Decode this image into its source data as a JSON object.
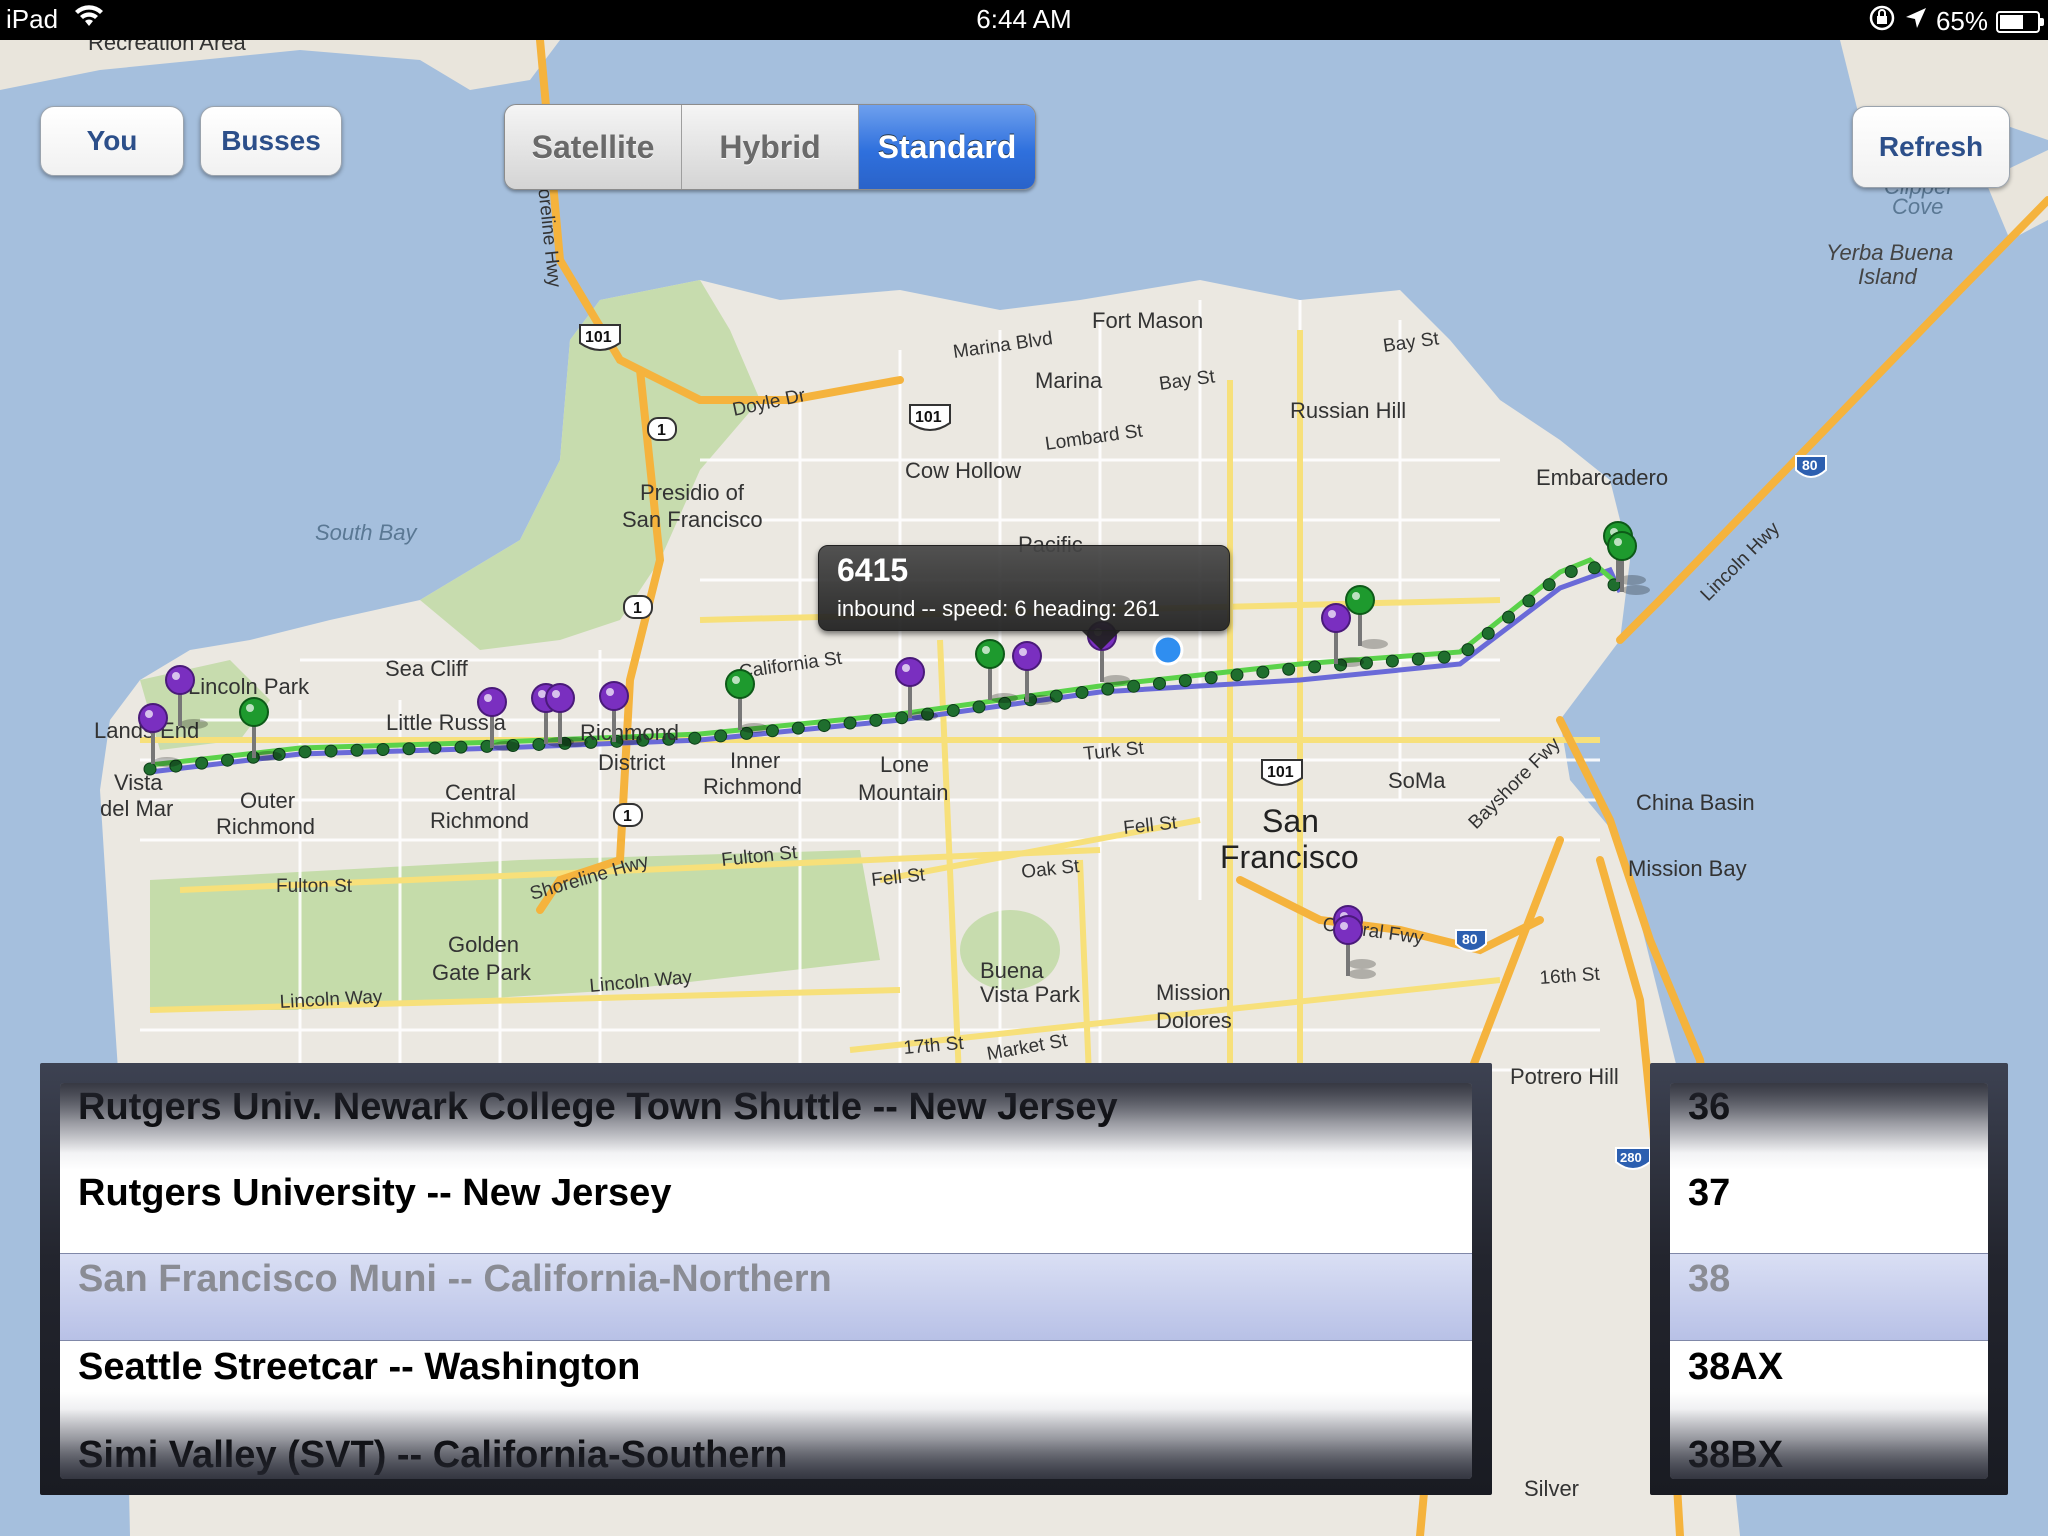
{
  "status": {
    "device": "iPad",
    "time": "6:44 AM",
    "battery": "65%",
    "battery_level": 0.65
  },
  "toolbar": {
    "you_label": "You",
    "busses_label": "Busses",
    "map_types": [
      {
        "label": "Satellite",
        "selected": false
      },
      {
        "label": "Hybrid",
        "selected": false
      },
      {
        "label": "Standard",
        "selected": true
      }
    ],
    "refresh_label": "Refresh"
  },
  "callout": {
    "title": "6415",
    "subtitle": "inbound -- speed:  6 heading: 261"
  },
  "map_labels": {
    "recreation_area": "Recreation Area",
    "south_bay": "South Bay",
    "presidio": "Presidio of",
    "san_francisco_small": "San Francisco",
    "marina": "Marina",
    "cow_hollow": "Cow Hollow",
    "fort_mason": "Fort Mason",
    "russian_hill": "Russian Hill",
    "embarcadero": "Embarcadero",
    "yerba": "Yerba Buena",
    "island": "Island",
    "clipper": "Clipper",
    "cove": "Cove",
    "lincoln_park": "Lincoln Park",
    "lands_end": "Lands End",
    "sea_cliff": "Sea Cliff",
    "little_russia": "Little Russia",
    "richmond": "Richmond",
    "district": "District",
    "inner": "Inner",
    "richmond2": "Richmond",
    "lone": "Lone",
    "mountain": "Mountain",
    "vista": "Vista",
    "del_mar": "del Mar",
    "outer": "Outer",
    "richmond3": "Richmond",
    "central": "Central",
    "richmond4": "Richmond",
    "san": "San",
    "francisco": "Francisco",
    "soma": "SoMa",
    "china_basin": "China Basin",
    "mission_bay": "Mission Bay",
    "golden": "Golden",
    "gate_park": "Gate Park",
    "buena": "Buena",
    "vista_park": "Vista Park",
    "mission": "Mission",
    "dolores": "Dolores",
    "potrero_hill": "Potrero Hill",
    "silver": "Silver",
    "pacific": "Pacific",
    "doyle_dr": "Doyle Dr",
    "marina_blvd": "Marina Blvd",
    "lombard_st": "Lombard St",
    "bay_st": "Bay St",
    "bay_st2": "Bay St",
    "california_st": "California St",
    "turk_st": "Turk St",
    "fell_st": "Fell St",
    "oak_st": "Oak St",
    "fulton_st": "Fulton St",
    "fulton_st2": "Fulton St",
    "lincoln_way": "Lincoln Way",
    "lincoln_way2": "Lincoln Way",
    "shoreline_hwy": "Shoreline Hwy",
    "shoreline_hwy2": "Shoreline Hwy",
    "bayshore_fwy": "Bayshore Fwy",
    "lincoln_hwy": "Lincoln Hwy",
    "sixteenth": "16th St",
    "seventeenth": "17th St",
    "market_st": "Market St",
    "central_fwy": "Central Fwy",
    "hwy101": "101",
    "hwy1": "1",
    "i80": "80",
    "i280": "280"
  },
  "agency_picker": {
    "rows": [
      "Rutgers Univ. Newark College Town Shuttle -- New Jersey",
      "Rutgers University -- New Jersey",
      "San Francisco Muni -- California-Northern",
      "Seattle Streetcar -- Washington",
      "Simi Valley (SVT) -- California-Southern"
    ],
    "selected_index": 2
  },
  "route_picker": {
    "rows": [
      "36",
      "37",
      "38",
      "38AX",
      "38BX"
    ],
    "selected_index": 2
  },
  "colors": {
    "accent": "#2f70dd",
    "route_green": "#5ad24a",
    "route_blue": "#6a6ad8",
    "pin_purple": "#7a2fc0",
    "pin_green": "#1e9a2e"
  }
}
